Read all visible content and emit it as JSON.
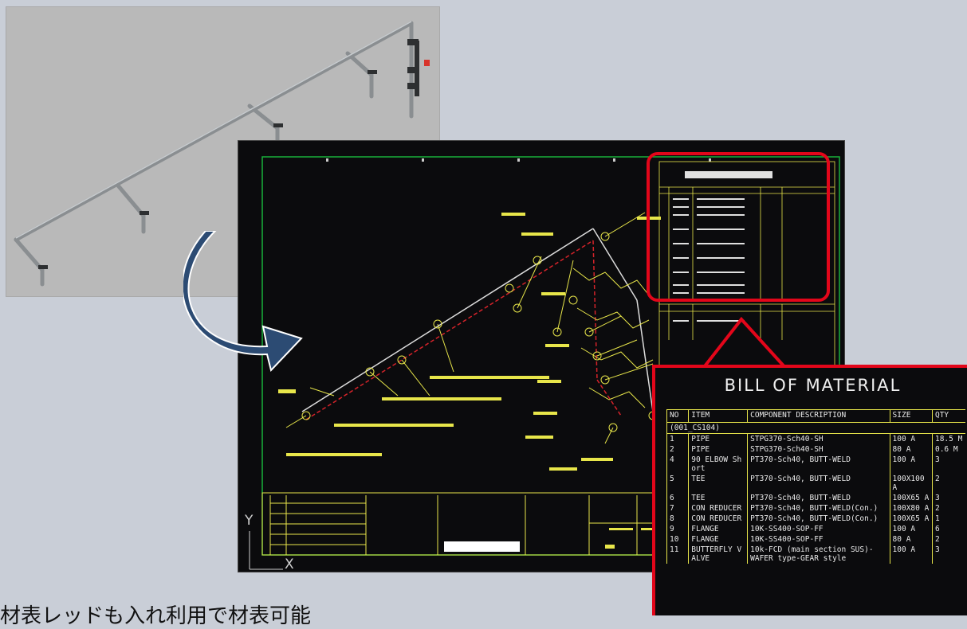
{
  "bom": {
    "title": "BILL OF MATERIAL",
    "headers": {
      "no": "NO",
      "item": "ITEM",
      "description": "COMPONENT DESCRIPTION",
      "size": "SIZE",
      "qty": "QTY"
    },
    "group": "(001_CS104)",
    "rows": [
      {
        "no": "1",
        "item": "PIPE",
        "description": "STPG370-Sch40-SH",
        "size": "100 A",
        "qty": "18.5 M"
      },
      {
        "no": "2",
        "item": "PIPE",
        "description": "STPG370-Sch40-SH",
        "size": "80 A",
        "qty": "0.6 M"
      },
      {
        "no": "4",
        "item": "90 ELBOW Sh ort",
        "description": "PT370-Sch40, BUTT-WELD",
        "size": "100 A",
        "qty": "3"
      },
      {
        "no": "5",
        "item": "TEE",
        "description": "PT370-Sch40, BUTT-WELD",
        "size": "100X100 A",
        "qty": "2"
      },
      {
        "no": "6",
        "item": "TEE",
        "description": "PT370-Sch40, BUTT-WELD",
        "size": "100X65 A",
        "qty": "3"
      },
      {
        "no": "7",
        "item": "CON REDUCER",
        "description": "PT370-Sch40, BUTT-WELD(Con.)",
        "size": "100X80 A",
        "qty": "2"
      },
      {
        "no": "8",
        "item": "CON REDUCER",
        "description": "PT370-Sch40, BUTT-WELD(Con.)",
        "size": "100X65 A",
        "qty": "1"
      },
      {
        "no": "9",
        "item": "FLANGE",
        "description": "10K-SS400-SOP-FF",
        "size": "100 A",
        "qty": "6"
      },
      {
        "no": "10",
        "item": "FLANGE",
        "description": "10K-SS400-SOP-FF",
        "size": "80 A",
        "qty": "2"
      },
      {
        "no": "11",
        "item": "BUTTERFLY V ALVE",
        "description": "10k-FCD (main section SUS)-WAFER type-GEAR style",
        "size": "100 A",
        "qty": "3"
      }
    ]
  },
  "caption": "材表レッドも入れ利用で材表可能",
  "colors": {
    "highlight": "#e3061a",
    "cad_background": "#0b0b0d",
    "cad_yellow": "#e8e64a",
    "cad_green": "#19b23b",
    "cad_red": "#d4232a",
    "arrow_fill": "#2c4b73"
  }
}
